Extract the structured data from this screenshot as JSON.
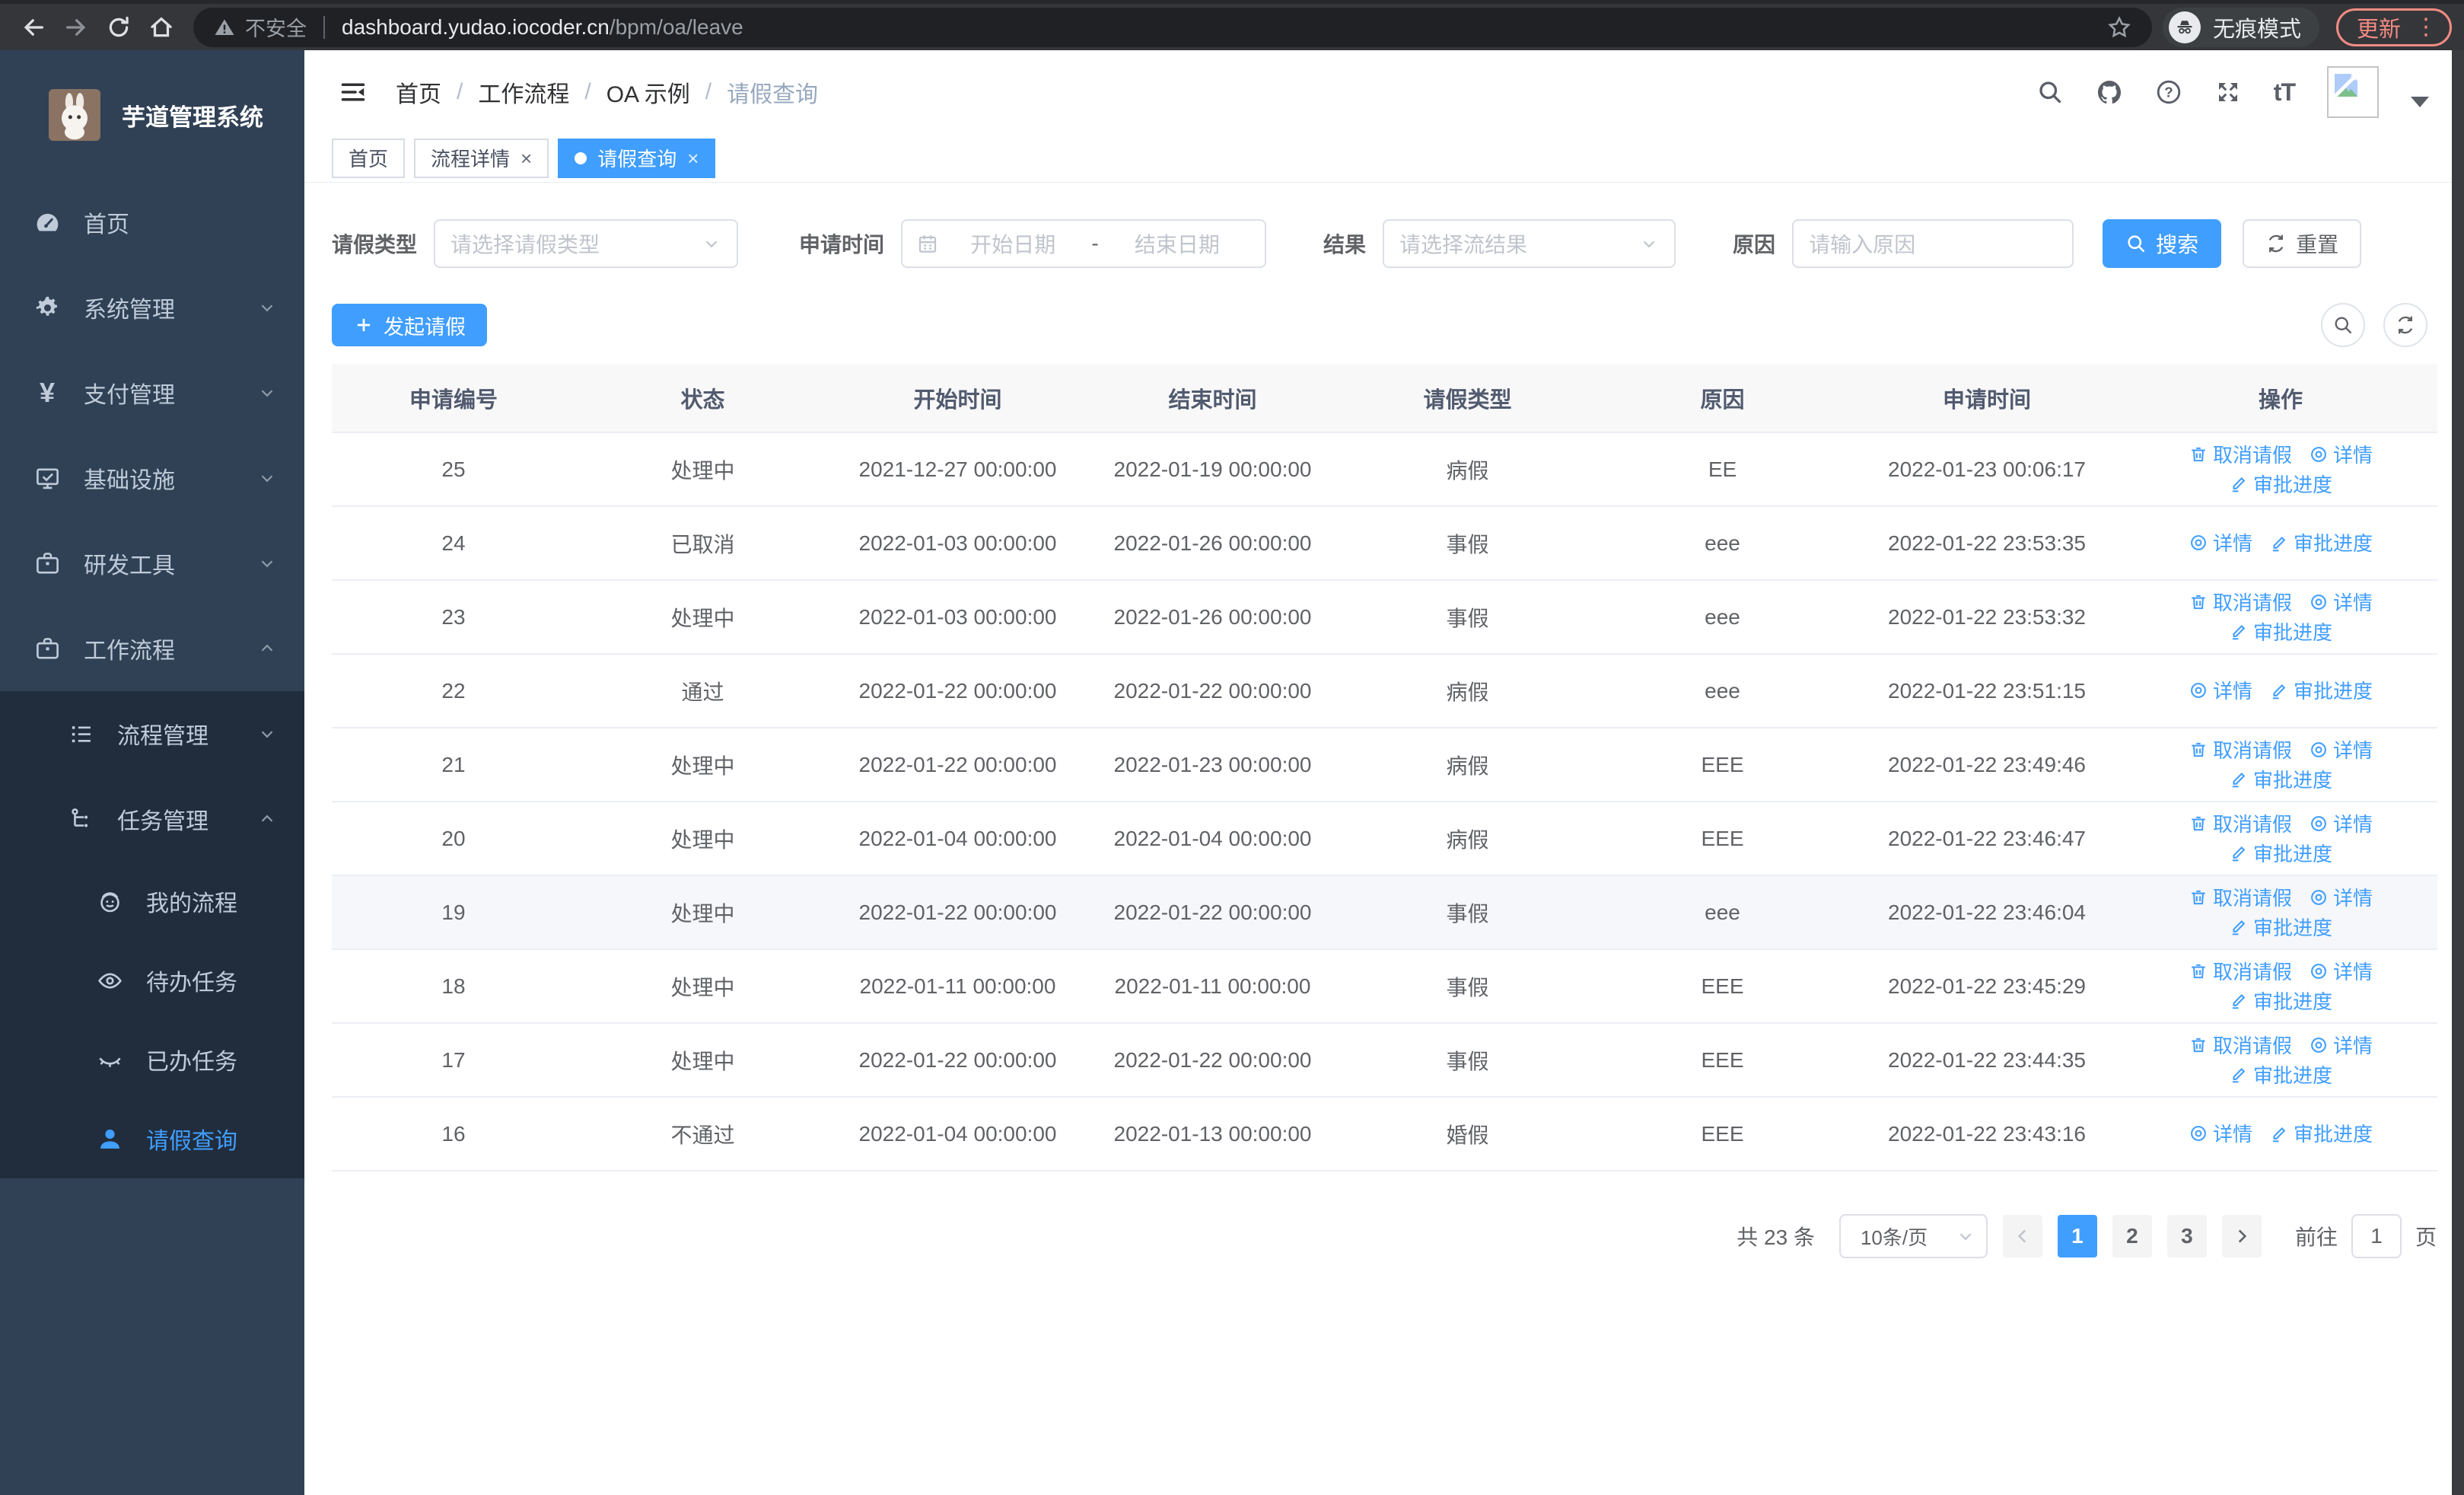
{
  "colors": {
    "accent": "#409eff",
    "sidebar_bg": "#304156",
    "submenu_bg": "#212d3d",
    "update_accent": "#f28b82",
    "link_blue": "#409eff"
  },
  "icons": {
    "yen": "¥",
    "text_size": "tT",
    "close": "×",
    "more_dots": "⋮"
  },
  "browser": {
    "security_label": "不安全",
    "url_host": "dashboard.yudao.iocoder.cn",
    "url_path": "/bpm/oa/leave",
    "incognito_label": "无痕模式",
    "update_label": "更新"
  },
  "sidebar": {
    "title": "芋道管理系统",
    "items": [
      {
        "label": "首页"
      },
      {
        "label": "系统管理"
      },
      {
        "label": "支付管理"
      },
      {
        "label": "基础设施"
      },
      {
        "label": "研发工具"
      },
      {
        "label": "工作流程"
      }
    ],
    "submenu": {
      "process_mgmt": "流程管理",
      "task_mgmt": "任务管理",
      "children": [
        {
          "label": "我的流程"
        },
        {
          "label": "待办任务"
        },
        {
          "label": "已办任务"
        },
        {
          "label": "请假查询"
        }
      ]
    }
  },
  "header": {
    "breadcrumb": [
      "首页",
      "工作流程",
      "OA 示例",
      "请假查询"
    ]
  },
  "tabs": [
    {
      "label": "首页"
    },
    {
      "label": "流程详情"
    },
    {
      "label": "请假查询"
    }
  ],
  "filters": {
    "type_label": "请假类型",
    "type_placeholder": "请选择请假类型",
    "time_label": "申请时间",
    "start_placeholder": "开始日期",
    "range_separator": "-",
    "end_placeholder": "结束日期",
    "result_label": "结果",
    "result_placeholder": "请选择流结果",
    "reason_label": "原因",
    "reason_placeholder": "请输入原因",
    "search_label": "搜索",
    "reset_label": "重置"
  },
  "toolbar": {
    "create_label": "发起请假"
  },
  "table": {
    "columns": [
      "申请编号",
      "状态",
      "开始时间",
      "结束时间",
      "请假类型",
      "原因",
      "申请时间",
      "操作"
    ],
    "col_keys": [
      "id",
      "status",
      "start",
      "end",
      "type",
      "reason",
      "apply_time"
    ],
    "action_labels": {
      "cancel": "取消请假",
      "detail": "详情",
      "progress": "审批进度"
    },
    "rows": [
      {
        "id": "25",
        "status": "处理中",
        "start": "2021-12-27 00:00:00",
        "end": "2022-01-19 00:00:00",
        "type": "病假",
        "reason": "EE",
        "apply_time": "2022-01-23 00:06:17",
        "actions": [
          "cancel",
          "detail",
          "progress"
        ],
        "highlight": false
      },
      {
        "id": "24",
        "status": "已取消",
        "start": "2022-01-03 00:00:00",
        "end": "2022-01-26 00:00:00",
        "type": "事假",
        "reason": "eee",
        "apply_time": "2022-01-22 23:53:35",
        "actions": [
          "detail",
          "progress"
        ],
        "highlight": false
      },
      {
        "id": "23",
        "status": "处理中",
        "start": "2022-01-03 00:00:00",
        "end": "2022-01-26 00:00:00",
        "type": "事假",
        "reason": "eee",
        "apply_time": "2022-01-22 23:53:32",
        "actions": [
          "cancel",
          "detail",
          "progress"
        ],
        "highlight": false
      },
      {
        "id": "22",
        "status": "通过",
        "start": "2022-01-22 00:00:00",
        "end": "2022-01-22 00:00:00",
        "type": "病假",
        "reason": "eee",
        "apply_time": "2022-01-22 23:51:15",
        "actions": [
          "detail",
          "progress"
        ],
        "highlight": false
      },
      {
        "id": "21",
        "status": "处理中",
        "start": "2022-01-22 00:00:00",
        "end": "2022-01-23 00:00:00",
        "type": "病假",
        "reason": "EEE",
        "apply_time": "2022-01-22 23:49:46",
        "actions": [
          "cancel",
          "detail",
          "progress"
        ],
        "highlight": false
      },
      {
        "id": "20",
        "status": "处理中",
        "start": "2022-01-04 00:00:00",
        "end": "2022-01-04 00:00:00",
        "type": "病假",
        "reason": "EEE",
        "apply_time": "2022-01-22 23:46:47",
        "actions": [
          "cancel",
          "detail",
          "progress"
        ],
        "highlight": false
      },
      {
        "id": "19",
        "status": "处理中",
        "start": "2022-01-22 00:00:00",
        "end": "2022-01-22 00:00:00",
        "type": "事假",
        "reason": "eee",
        "apply_time": "2022-01-22 23:46:04",
        "actions": [
          "cancel",
          "detail",
          "progress"
        ],
        "highlight": true
      },
      {
        "id": "18",
        "status": "处理中",
        "start": "2022-01-11 00:00:00",
        "end": "2022-01-11 00:00:00",
        "type": "事假",
        "reason": "EEE",
        "apply_time": "2022-01-22 23:45:29",
        "actions": [
          "cancel",
          "detail",
          "progress"
        ],
        "highlight": false
      },
      {
        "id": "17",
        "status": "处理中",
        "start": "2022-01-22 00:00:00",
        "end": "2022-01-22 00:00:00",
        "type": "事假",
        "reason": "EEE",
        "apply_time": "2022-01-22 23:44:35",
        "actions": [
          "cancel",
          "detail",
          "progress"
        ],
        "highlight": false
      },
      {
        "id": "16",
        "status": "不通过",
        "start": "2022-01-04 00:00:00",
        "end": "2022-01-13 00:00:00",
        "type": "婚假",
        "reason": "EEE",
        "apply_time": "2022-01-22 23:43:16",
        "actions": [
          "detail",
          "progress"
        ],
        "highlight": false
      }
    ]
  },
  "pagination": {
    "total_label": "共 23 条",
    "page_size": "10条/页",
    "pages": [
      "1",
      "2",
      "3"
    ],
    "active_page": "1",
    "goto_label": "前往",
    "goto_value": "1",
    "page_unit": "页"
  }
}
